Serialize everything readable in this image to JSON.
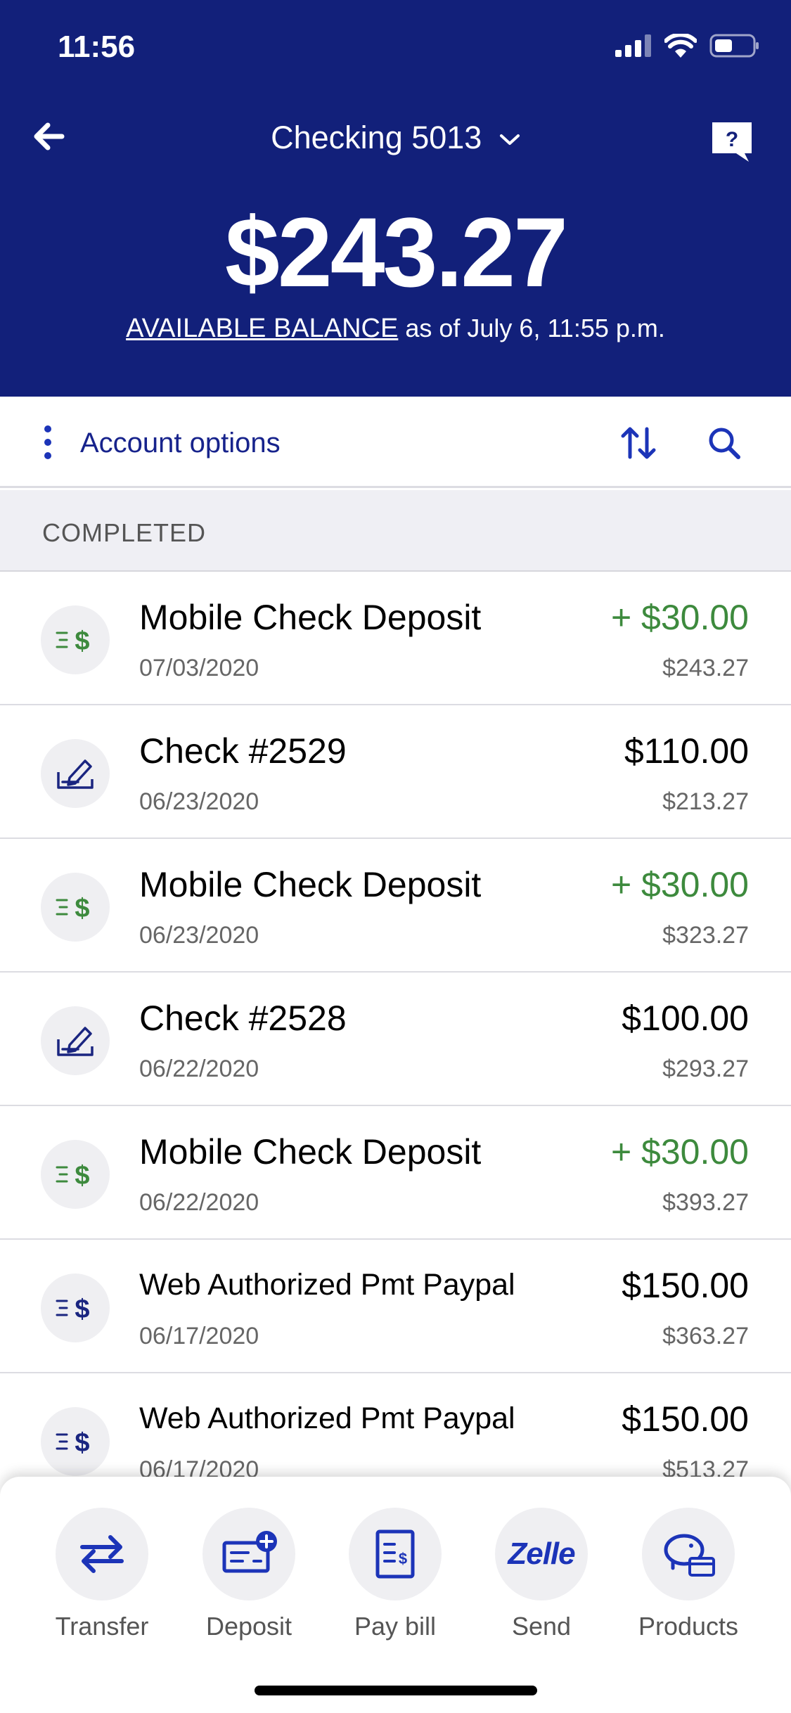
{
  "status_bar": {
    "time": "11:56"
  },
  "header": {
    "account_title": "Checking 5013",
    "balance": "$243.27",
    "balance_label": "AVAILABLE BALANCE",
    "balance_as_of": " as of July 6, 11:55 p.m."
  },
  "options": {
    "label": "Account options"
  },
  "section": {
    "title": "COMPLETED"
  },
  "transactions": [
    {
      "name": "Mobile Check Deposit",
      "date": "07/03/2020",
      "amount": "+ $30.00",
      "running_balance": "$243.27",
      "type": "credit",
      "icon": "deposit-dollar-icon"
    },
    {
      "name": "Check #2529",
      "date": "06/23/2020",
      "amount": "$110.00",
      "running_balance": "$213.27",
      "type": "debit",
      "icon": "check-pen-icon"
    },
    {
      "name": "Mobile Check Deposit",
      "date": "06/23/2020",
      "amount": "+ $30.00",
      "running_balance": "$323.27",
      "type": "credit",
      "icon": "deposit-dollar-icon"
    },
    {
      "name": "Check #2528",
      "date": "06/22/2020",
      "amount": "$100.00",
      "running_balance": "$293.27",
      "type": "debit",
      "icon": "check-pen-icon"
    },
    {
      "name": "Mobile Check Deposit",
      "date": "06/22/2020",
      "amount": "+ $30.00",
      "running_balance": "$393.27",
      "type": "credit",
      "icon": "deposit-dollar-icon"
    },
    {
      "name": "Web Authorized Pmt Paypal",
      "date": "06/17/2020",
      "amount": "$150.00",
      "running_balance": "$363.27",
      "type": "debit",
      "icon": "payment-dollar-icon"
    },
    {
      "name": "Web Authorized Pmt Paypal",
      "date": "06/17/2020",
      "amount": "$150.00",
      "running_balance": "$513.27",
      "type": "debit",
      "icon": "payment-dollar-icon"
    }
  ],
  "actions": [
    {
      "label": "Transfer",
      "icon": "transfer-arrows-icon"
    },
    {
      "label": "Deposit",
      "icon": "deposit-check-icon"
    },
    {
      "label": "Pay bill",
      "icon": "bill-icon"
    },
    {
      "label": "Send",
      "icon": "zelle-logo",
      "logo_text": "Zelle"
    },
    {
      "label": "Products",
      "icon": "piggy-bank-icon"
    }
  ],
  "colors": {
    "header_bg": "#12207a",
    "accent": "#17238c",
    "credit_green": "#3d8a3d"
  }
}
